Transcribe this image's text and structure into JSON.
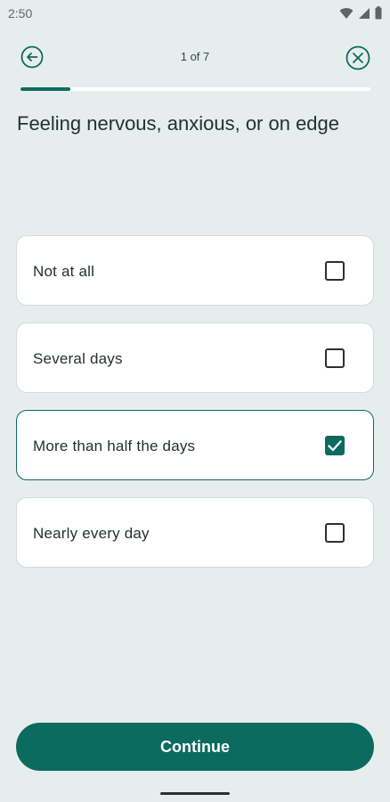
{
  "status_bar": {
    "time": "2:50"
  },
  "header": {
    "progress_text": "1 of 7",
    "progress_fraction": 0.143
  },
  "question": "Feeling nervous, anxious, or on edge",
  "options": [
    {
      "label": "Not at all",
      "checked": false
    },
    {
      "label": "Several days",
      "checked": false
    },
    {
      "label": "More than half the days",
      "checked": true
    },
    {
      "label": "Nearly every day",
      "checked": false
    }
  ],
  "continue_label": "Continue",
  "colors": {
    "accent": "#0b6b5f",
    "background": "#e6eeed",
    "card": "#ffffff"
  },
  "icons": {
    "back": "arrow-left-circle-icon",
    "close": "close-circle-icon"
  }
}
